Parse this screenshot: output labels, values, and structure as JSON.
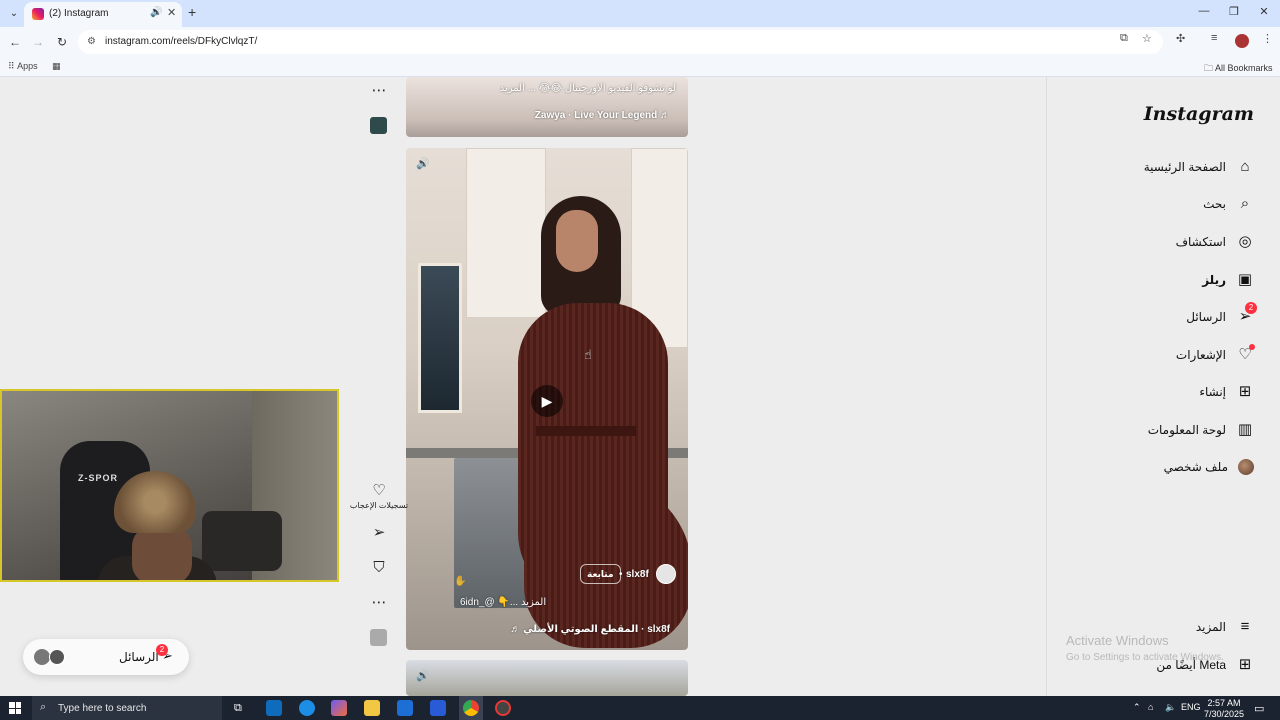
{
  "browser": {
    "tab_title": "(2) Instagram",
    "url": "instagram.com/reels/DFkyClvlqzT/",
    "bookmarks_apps": "Apps",
    "bookmarks_all": "All Bookmarks"
  },
  "sidebar": {
    "logo": "Instagram",
    "items": [
      {
        "label": "الصفحة الرئيسية",
        "icon": "home-icon",
        "glyph": "⌂"
      },
      {
        "label": "بحث",
        "icon": "search-icon",
        "glyph": "⌕"
      },
      {
        "label": "استكشاف",
        "icon": "compass-icon",
        "glyph": "◎"
      },
      {
        "label": "ريلز",
        "icon": "reels-icon",
        "glyph": "▣"
      },
      {
        "label": "الرسائل",
        "icon": "messenger-icon",
        "glyph": "➢",
        "badge": "2"
      },
      {
        "label": "الإشعارات",
        "icon": "heart-icon",
        "glyph": "♡"
      },
      {
        "label": "إنشاء",
        "icon": "create-icon",
        "glyph": "⊞"
      },
      {
        "label": "لوحة المعلومات",
        "icon": "dashboard-icon",
        "glyph": "▥"
      },
      {
        "label": "ملف شخصي",
        "icon": "profile-avatar"
      }
    ],
    "more_label": "المزيد",
    "meta_label": "أيضًا من Meta"
  },
  "reel_top": {
    "caption": "لو تشوفو الفيديو الاورجينال 😂😂 ... المزيد",
    "audio": "Zawya · Live Your Legend ♬"
  },
  "reel_main": {
    "username": "slx8f",
    "follow_label": "متابعة",
    "caption": "6idn_@ 👇... المزيد",
    "audio": "♬ المقطع الصوتي الأصلي · slx8f"
  },
  "actions": {
    "likes_label": "تسجيلات الإعجاب"
  },
  "messages_pill": {
    "label": "الرسائل",
    "badge": "2"
  },
  "watermark": {
    "line1": "Activate Windows",
    "line2": "Go to Settings to activate Windows."
  },
  "taskbar": {
    "search_placeholder": "Type here to search",
    "lang": "ENG",
    "time": "2:57 AM",
    "date": "7/30/2025"
  }
}
